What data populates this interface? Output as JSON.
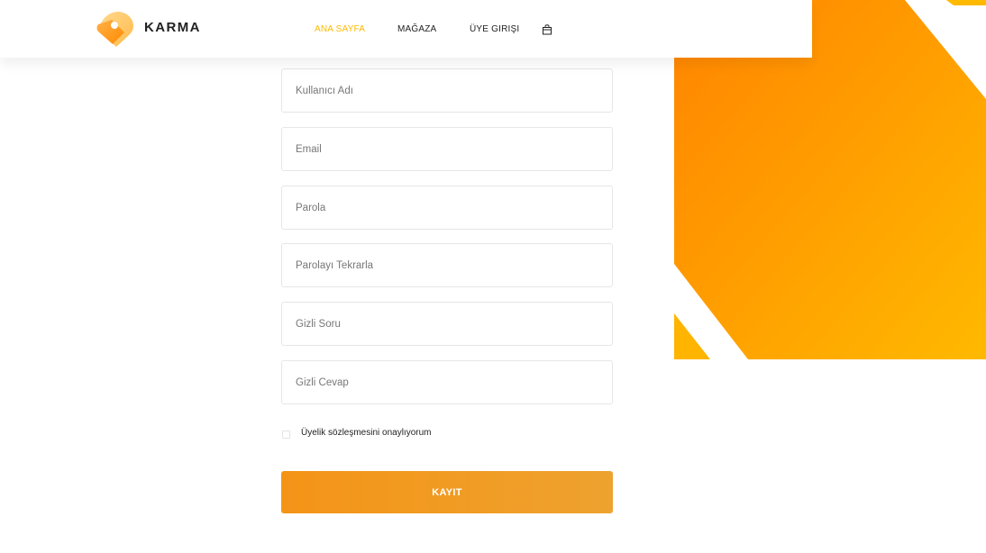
{
  "header": {
    "brand": "KARMA",
    "nav": [
      {
        "label": "ANA SAYFA",
        "active": true
      },
      {
        "label": "MAĞAZA",
        "active": false
      },
      {
        "label": "ÜYE GIRIŞI",
        "active": false
      }
    ],
    "cart_icon": "shopping-bag-icon"
  },
  "form": {
    "fields": [
      {
        "placeholder": "Kullanıcı Adı",
        "type": "text"
      },
      {
        "placeholder": "Email",
        "type": "email"
      },
      {
        "placeholder": "Parola",
        "type": "password"
      },
      {
        "placeholder": "Parolayı Tekrarla",
        "type": "password"
      },
      {
        "placeholder": "Gizli Soru",
        "type": "text"
      },
      {
        "placeholder": "Gizli Cevap",
        "type": "text"
      }
    ],
    "agreement_label": "Üyelik sözleşmesini onaylıyorum",
    "agreement_checked": false,
    "submit_label": "KAYIT"
  },
  "colors": {
    "accent": "#ffba00",
    "banner_start": "#ff8a00",
    "banner_end": "#ffba00",
    "button_start": "#f49417",
    "button_end": "#eea22f"
  }
}
